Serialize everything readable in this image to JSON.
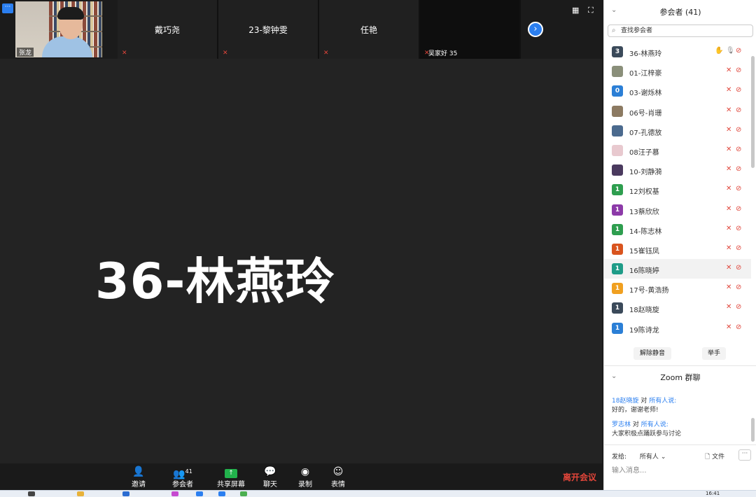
{
  "top_strip": {
    "self_name": "张龙",
    "tiles": [
      {
        "name": "戴巧尧"
      },
      {
        "name": "23-黎钟雯"
      },
      {
        "name": "任艳"
      },
      {
        "name": "",
        "label": "吴家好 35"
      }
    ]
  },
  "main": {
    "speaker_name": "36-林燕玲"
  },
  "toolbar": {
    "items": [
      {
        "label": "邀请",
        "icon": "invite-icon"
      },
      {
        "label": "参会者",
        "icon": "participants-icon",
        "count": "41"
      },
      {
        "label": "共享屏幕",
        "icon": "share-screen-icon"
      },
      {
        "label": "聊天",
        "icon": "chat-icon"
      },
      {
        "label": "录制",
        "icon": "record-icon"
      },
      {
        "label": "表情",
        "icon": "reaction-icon"
      }
    ],
    "leave_label": "离开会议"
  },
  "participants_panel": {
    "title": "参会者 (41)",
    "search_placeholder": "查找参会者",
    "participants": [
      {
        "name": "36-林燕玲",
        "avatar_text": "3",
        "avatar_color": "#3b4a5a",
        "hand": true,
        "mic_on": true
      },
      {
        "name": "01-江梓豪",
        "avatar_text": "",
        "avatar_color": "#8a8f7a"
      },
      {
        "name": "03-谢烁林",
        "avatar_text": "0",
        "avatar_color": "#2b7fd6"
      },
      {
        "name": "06号-肖珊",
        "avatar_text": "",
        "avatar_color": "#8c7a62"
      },
      {
        "name": "07-孔德放",
        "avatar_text": "",
        "avatar_color": "#4b6a8e"
      },
      {
        "name": "08汪子慕",
        "avatar_text": "",
        "avatar_color": "#e8c9cf"
      },
      {
        "name": "10-刘静漪",
        "avatar_text": "",
        "avatar_color": "#4a3a5e"
      },
      {
        "name": "12刘权基",
        "avatar_text": "1",
        "avatar_color": "#2e9e4f"
      },
      {
        "name": "13蔡欣欣",
        "avatar_text": "1",
        "avatar_color": "#8c3aa8"
      },
      {
        "name": "14-陈志林",
        "avatar_text": "1",
        "avatar_color": "#2e9e4f"
      },
      {
        "name": "15崔钰凤",
        "avatar_text": "1",
        "avatar_color": "#d9541e"
      },
      {
        "name": "16陈晓婷",
        "avatar_text": "1",
        "avatar_color": "#1f9c88"
      },
      {
        "name": "17号-黄浩扬",
        "avatar_text": "1",
        "avatar_color": "#f0a020"
      },
      {
        "name": "18赵晓旋",
        "avatar_text": "1",
        "avatar_color": "#3b4a5a"
      },
      {
        "name": "19陈诗龙",
        "avatar_text": "1",
        "avatar_color": "#2b7fd6"
      }
    ],
    "unmute_label": "解除静音",
    "raise_hand_label": "举手"
  },
  "chat_panel": {
    "title": "Zoom 群聊",
    "messages": [
      {
        "from": "18赵晓旋",
        "to_word": "对",
        "to": "所有人说:",
        "text": "好的，谢谢老师!"
      },
      {
        "from": "罗志林",
        "to_word": "对",
        "to": "所有人说:",
        "text": "大家积极点踊跃参与讨论"
      }
    ],
    "send_to_label": "发给:",
    "send_to_value": "所有人",
    "file_label": "文件",
    "more_label": "···",
    "input_placeholder": "输入消息..."
  },
  "taskbar": {
    "time": "16:41"
  }
}
